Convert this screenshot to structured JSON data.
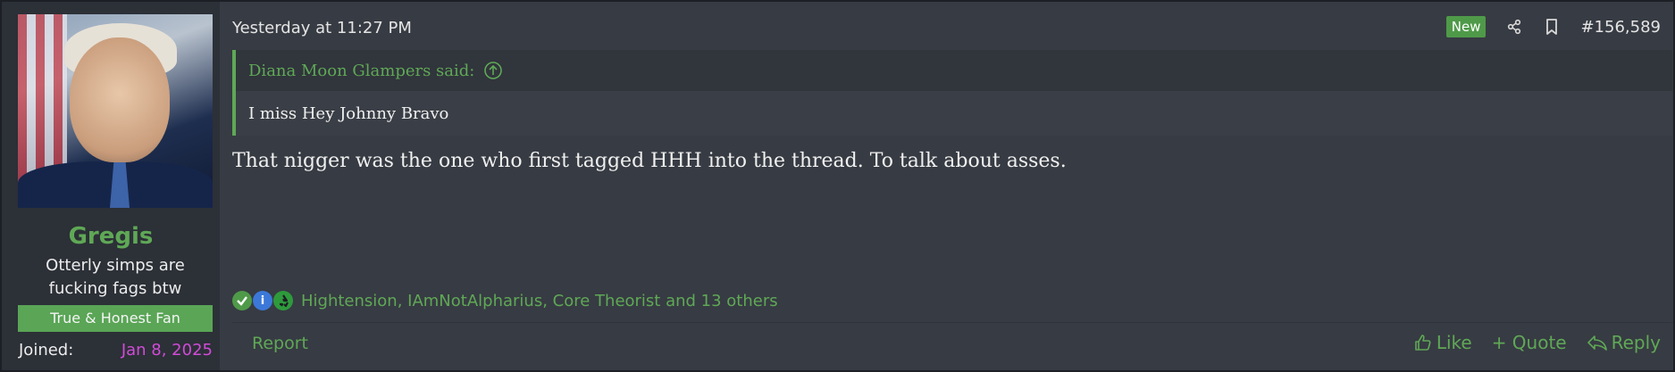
{
  "user": {
    "name": "Gregis",
    "title": "Otterly simps are fucking fags btw",
    "banner": "True & Honest Fan",
    "joined_label": "Joined:",
    "joined_value": "Jan 8, 2025"
  },
  "header": {
    "date": "Yesterday at 11:27 PM",
    "new_badge": "New",
    "share_icon": "share-icon",
    "bookmark_icon": "bookmark-icon",
    "post_number": "#156,589"
  },
  "quote": {
    "author": "Diana Moon Glampers said:",
    "jump_icon": "arrow-up-circle-icon",
    "text": "I miss Hey Johnny Bravo"
  },
  "post": {
    "text": "That nigger was the one who first tagged HHH into the thread. To talk about asses."
  },
  "reactions": {
    "icons": [
      "check-icon",
      "info-icon",
      "recycle-icon"
    ],
    "list": "Hightension, IAmNotAlpharius, Core Theorist and 13 others"
  },
  "footer": {
    "report": "Report",
    "like": "Like",
    "quote": "+ Quote",
    "reply": "Reply"
  },
  "colors": {
    "accent": "#5fa856",
    "joined_date": "#d14bd8",
    "post_bg": "#373b43",
    "user_col_bg": "#2c3037"
  }
}
